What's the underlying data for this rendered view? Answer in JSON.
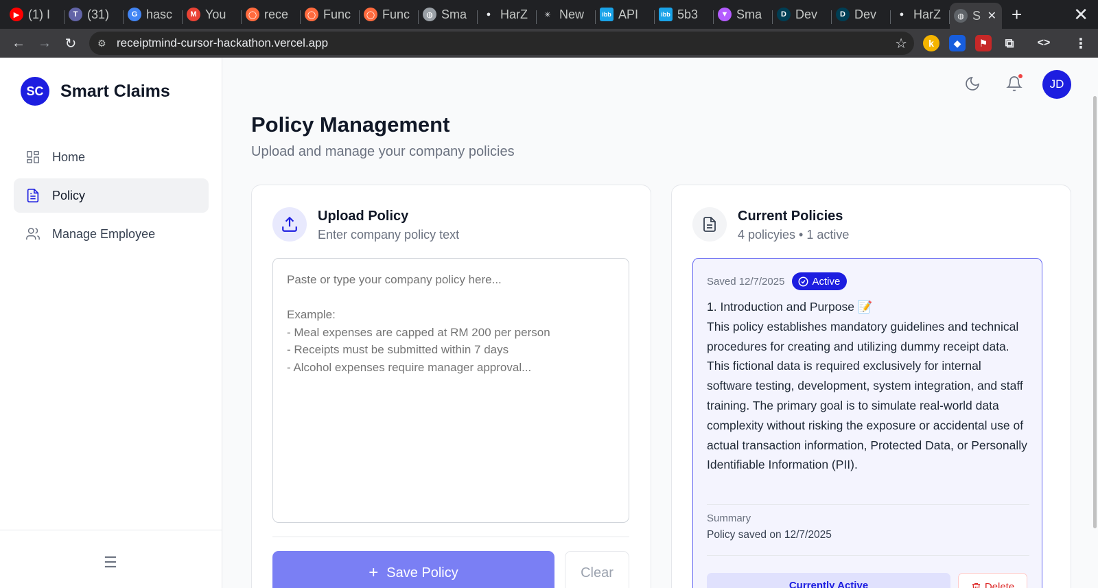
{
  "browser": {
    "tabs": [
      {
        "label": "(1) I",
        "icon": "youtube-icon",
        "color": "#ff0000"
      },
      {
        "label": "(31)",
        "icon": "teams-icon",
        "color": "#6264a7"
      },
      {
        "label": "hasc",
        "icon": "google-icon",
        "color": "#4285f4"
      },
      {
        "label": "You",
        "icon": "gmail-icon",
        "color": "#ea4335"
      },
      {
        "label": "rece",
        "icon": "ring-icon",
        "color": "#ff6a3d"
      },
      {
        "label": "Func",
        "icon": "ring-icon",
        "color": "#ff6a3d"
      },
      {
        "label": "Func",
        "icon": "ring-icon",
        "color": "#ff6a3d"
      },
      {
        "label": "Sma",
        "icon": "globe-icon",
        "color": "#9aa0a6"
      },
      {
        "label": "HarZ",
        "icon": "github-icon",
        "color": "#e8eaed"
      },
      {
        "label": "New",
        "icon": "asterisk-icon",
        "color": "#e8eaed"
      },
      {
        "label": "API",
        "icon": "ibb-icon",
        "color": "#1aa3e8"
      },
      {
        "label": "5b3",
        "icon": "ibb-icon",
        "color": "#1aa3e8"
      },
      {
        "label": "Sma",
        "icon": "vite-icon",
        "color": "#b45cff"
      },
      {
        "label": "Dev",
        "icon": "devpost-icon",
        "color": "#003e54"
      },
      {
        "label": "Dev",
        "icon": "devpost-icon",
        "color": "#003e54"
      },
      {
        "label": "HarZ",
        "icon": "github-icon",
        "color": "#e8eaed"
      }
    ],
    "active_tab": {
      "label": "S",
      "icon": "globe-icon"
    },
    "url": "receiptmind-cursor-hackathon.vercel.app"
  },
  "app": {
    "logo_text": "SC",
    "brand": "Smart Claims",
    "nav": [
      {
        "label": "Home",
        "icon": "grid-icon"
      },
      {
        "label": "Policy",
        "icon": "document-icon",
        "active": true
      },
      {
        "label": "Manage Employee",
        "icon": "users-icon"
      }
    ],
    "user_initials": "JD",
    "page_title": "Policy Management",
    "page_subtitle": "Upload and manage your company policies"
  },
  "upload": {
    "title": "Upload Policy",
    "description": "Enter company policy text",
    "placeholder": "Paste or type your company policy here...\n\nExample:\n- Meal expenses are capped at RM 200 per person\n- Receipts must be submitted within 7 days\n- Alcohol expenses require manager approval...",
    "save_label": "Save Policy",
    "clear_label": "Clear"
  },
  "policies": {
    "title": "Current Policies",
    "description": "4 policyies • 1 active",
    "item": {
      "saved": "Saved 12/7/2025",
      "badge": "Active",
      "heading": "1. Introduction and Purpose 📝",
      "body": "This policy establishes mandatory guidelines and technical procedures for creating and utilizing dummy receipt data. This fictional data is required exclusively for internal software testing, development, system integration, and staff training. The primary goal is to simulate real-world data complexity without risking the exposure or accidental use of actual transaction information, Protected Data, or Personally Identifiable Information (PII).",
      "summary_label": "Summary",
      "summary_text": "Policy saved on 12/7/2025",
      "active_button": "Currently Active",
      "delete_button": "Delete"
    }
  },
  "colors": {
    "brand": "#1d1ee0",
    "save_button": "#7a7ff4",
    "active_card_border": "#6366f1",
    "danger": "#dc2626"
  }
}
